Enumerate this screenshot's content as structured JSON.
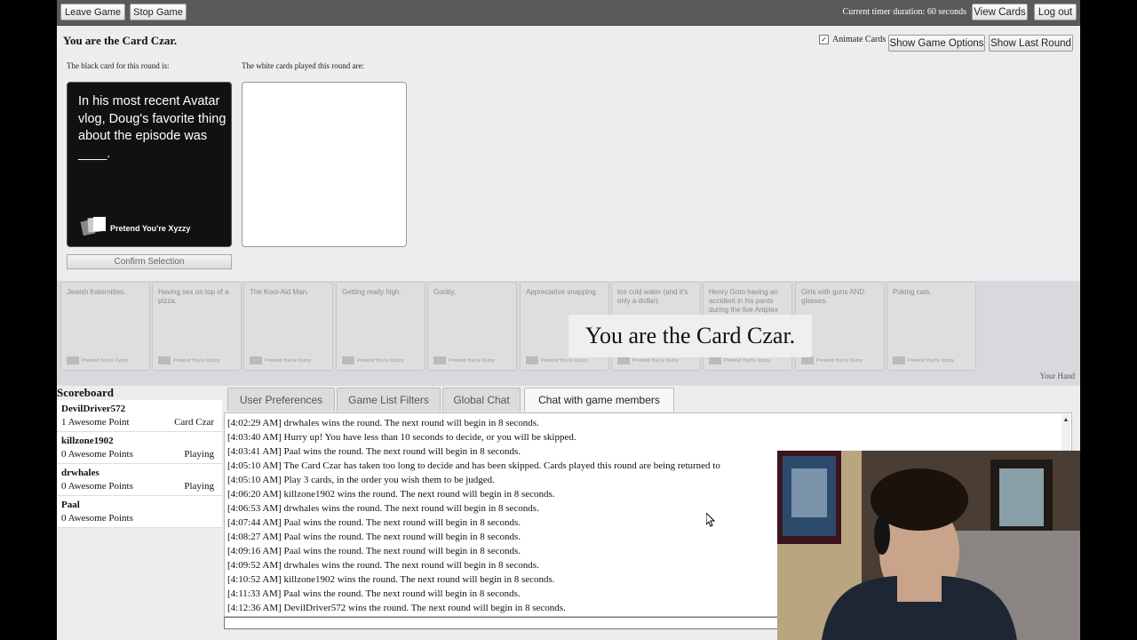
{
  "topbar": {
    "leave_label": "Leave Game",
    "stop_label": "Stop Game",
    "timer_text": "Current timer duration: 60 seconds",
    "view_cards_label": "View Cards",
    "logout_label": "Log out"
  },
  "game": {
    "czar_title": "You are the Card Czar.",
    "animate_label": "Animate Cards",
    "options_label": "Show Game Options",
    "last_round_label": "Show Last Round",
    "black_label": "The black card for this round is:",
    "white_label": "The white cards played this round are:",
    "black_card_text": "In his most recent Avatar vlog, Doug's favorite thing about the episode was ____.",
    "card_brand": "Pretend You're Xyzzy",
    "confirm_label": "Confirm Selection"
  },
  "hand": {
    "cards": [
      {
        "text": "Jewish fraternities."
      },
      {
        "text": "Having sex on top of a pizza."
      },
      {
        "text": "The Kool-Aid Man."
      },
      {
        "text": "Getting really high."
      },
      {
        "text": "Gooby."
      },
      {
        "text": "Appreciative snapping."
      },
      {
        "text": "Ice cold water (and it's only a dollar)."
      },
      {
        "text": "Henry Goto having an accident in his pants during the live Aniplex"
      },
      {
        "text": "Girls with guns AND glasses."
      },
      {
        "text": "Poking cats."
      }
    ],
    "card_brand": "Pretend You're Xyzzy",
    "overlay_text": "You are the Card Czar.",
    "your_hand_label": "Your Hand"
  },
  "scoreboard": {
    "title": "Scoreboard",
    "players": [
      {
        "name": "DevilDriver572",
        "points": "1 Awesome Point",
        "status": "Card Czar"
      },
      {
        "name": "killzone1902",
        "points": "0 Awesome Points",
        "status": "Playing"
      },
      {
        "name": "drwhales",
        "points": "0 Awesome Points",
        "status": "Playing"
      },
      {
        "name": "Paal",
        "points": "0 Awesome Points",
        "status": ""
      }
    ]
  },
  "tabs": [
    {
      "label": "User Preferences"
    },
    {
      "label": "Game List Filters"
    },
    {
      "label": "Global Chat"
    },
    {
      "label": "Chat with game members"
    }
  ],
  "chat": {
    "lines": [
      "[4:02:29 AM] drwhales wins the round. The next round will begin in 8 seconds.",
      "[4:03:40 AM] Hurry up! You have less than 10 seconds to decide, or you will be skipped.",
      "[4:03:41 AM] Paal wins the round. The next round will begin in 8 seconds.",
      "[4:05:10 AM] The Card Czar has taken too long to decide and has been skipped. Cards played this round are being returned to",
      "[4:05:10 AM] Play 3 cards, in the order you wish them to be judged.",
      "[4:06:20 AM] killzone1902 wins the round. The next round will begin in 8 seconds.",
      "[4:06:53 AM] drwhales wins the round. The next round will begin in 8 seconds.",
      "[4:07:44 AM] Paal wins the round. The next round will begin in 8 seconds.",
      "[4:08:27 AM] Paal wins the round. The next round will begin in 8 seconds.",
      "[4:09:16 AM] Paal wins the round. The next round will begin in 8 seconds.",
      "[4:09:52 AM] drwhales wins the round. The next round will begin in 8 seconds.",
      "[4:10:52 AM] killzone1902 wins the round. The next round will begin in 8 seconds.",
      "[4:11:33 AM] Paal wins the round. The next round will begin in 8 seconds.",
      "[4:12:36 AM] DevilDriver572 wins the round. The next round will begin in 8 seconds."
    ]
  }
}
